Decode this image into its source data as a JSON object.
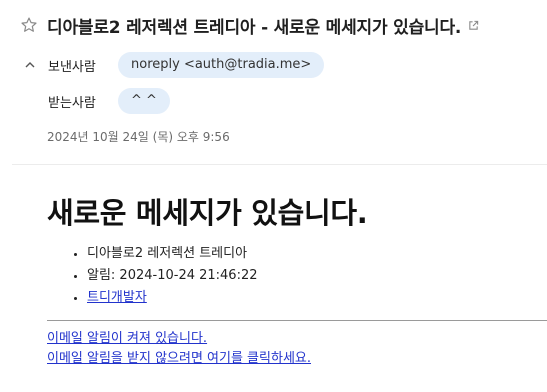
{
  "email": {
    "subject": "디아블로2 레저렉션 트레디아 - 새로운 메세지가 있습니다.",
    "from_label": "보낸사람",
    "from_value": "noreply <auth@tradia.me>",
    "to_label": "받는사람",
    "to_value": "^ ^",
    "date": "2024년 10월 24일 (목) 오후 9:56"
  },
  "body": {
    "headline": "새로운 메세지가 있습니다.",
    "items": [
      "디아블로2 레저렉션 트레디아",
      "알림: 2024-10-24 21:46:22",
      "트디개발자"
    ],
    "footer_line1": "이메일 알림이 켜져 있습니다.",
    "footer_line2": "이메일 알림을 받지 않으려면 여기를 클릭하세요."
  },
  "icons": {
    "star": "star-icon",
    "popout": "external-link-icon",
    "chevron": "chevron-up-icon"
  },
  "colors": {
    "chip_bg": "#e3eefa",
    "link": "#2233cc"
  }
}
